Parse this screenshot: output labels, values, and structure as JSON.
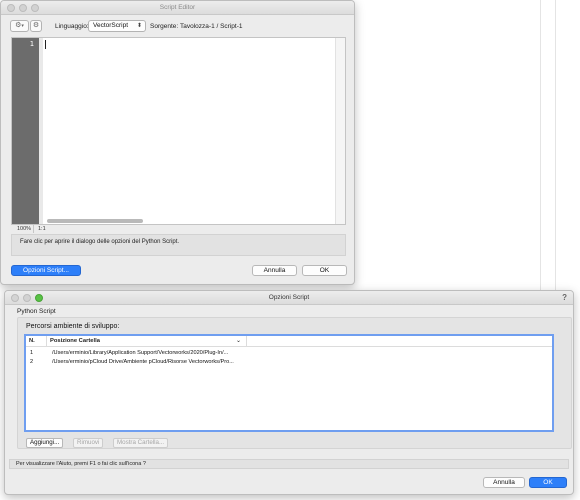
{
  "script_editor": {
    "title": "Script Editor",
    "language_label": "Linguaggio:",
    "language_value": "VectorScript",
    "source_label": "Sorgente:",
    "source_value": "Tavolozza-1 / Script-1",
    "line_number": "1",
    "zoom": "100%",
    "cursor_pos": "1:1",
    "help_text": "Fare clic per aprire il dialogo delle opzioni del Python Script.",
    "options_button": "Opzioni Script...",
    "cancel_button": "Annulla",
    "ok_button": "OK",
    "icons": [
      "gear-icon",
      "chevron-down-icon",
      "double-chevron-icon"
    ]
  },
  "script_options": {
    "title": "Opzioni Script",
    "help_mark": "?",
    "section": "Python Script",
    "group_heading": "Percorsi ambiente di sviluppo:",
    "table": {
      "columns": [
        "N.",
        "Posizione Cartella"
      ],
      "rows": [
        {
          "n": "1",
          "path": "/Users/erminio/Library/Application Support/Vectorworks/2020/Plug-In/..."
        },
        {
          "n": "2",
          "path": "/Users/erminio/pCloud Drive/Ambiente pCloud/Risorse Vectorworks/Pro..."
        }
      ]
    },
    "buttons": {
      "add": "Aggiungi...",
      "remove": "Rimuovi",
      "show_folder": "Mostra Cartella..."
    },
    "help_text": "Per visualizzare l'Aiuto, premi F1 o fai clic sull'icona ?",
    "cancel_button": "Annulla",
    "ok_button": "OK"
  },
  "colors": {
    "accent": "#2d7ff9",
    "gutter": "#6c6c6c",
    "selection_border": "#6f9ef0"
  }
}
